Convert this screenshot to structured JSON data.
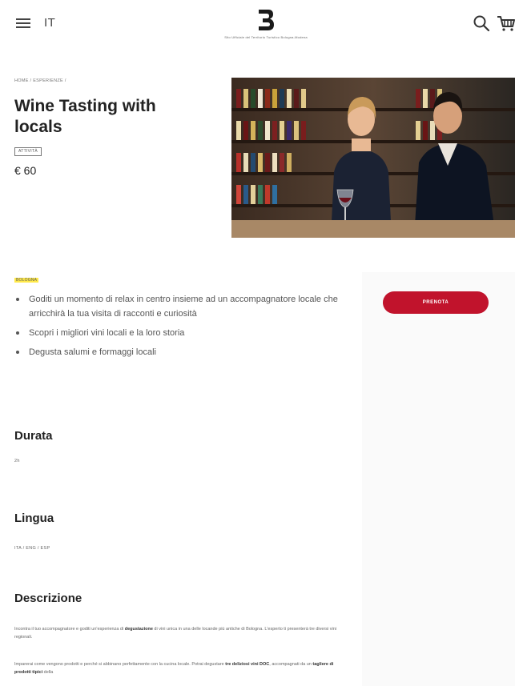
{
  "header": {
    "language": "IT",
    "logo_caption": "Sito Ufficiale del Territorio Turistico Bologna-Modena",
    "icons": [
      "menu-icon",
      "search-icon",
      "cart-icon"
    ]
  },
  "breadcrumb": {
    "home": "HOME",
    "separator": " / ",
    "section": "ESPERIENZE",
    "trailing": " /"
  },
  "product": {
    "title": "Wine Tasting with locals",
    "tag": "ATTIVITÀ",
    "price": "€ 60"
  },
  "details": {
    "city": "BOLOGNA",
    "highlights": [
      "Goditi un momento di relax in centro insieme ad un accompagnatore locale che arricchirà la tua visita di racconti e curiosità",
      "Scopri i migliori vini locali e la loro storia",
      "Degusta salumi e formaggi locali"
    ],
    "duration_title": "Durata",
    "duration_value": "2h",
    "language_title": "Lingua",
    "language_value": "ITA / ENG / ESP",
    "description_title": "Descrizione",
    "description_p1_a": "Incontra il tuo accompagnatore e goditi un'esperienza di ",
    "description_p1_b": "degustazione",
    "description_p1_c": " di vini unica in una delle locande più antiche di Bologna. L'esperto ti presenterà tre diversi vini regionali.",
    "description_p2_a": "Imparerai come vengono prodotti e perché si abbinano perfettamente con la cucina locale. Potrai degustare ",
    "description_p2_b": "tre deliziosi vini DOC",
    "description_p2_c": ", accompagnati da un ",
    "description_p2_d": "tagliere di prodotti tipici",
    "description_p2_e": " della"
  },
  "booking": {
    "button_label": "PRENOTA"
  },
  "colors": {
    "accent": "#c1132c",
    "highlight": "#ffe94a"
  }
}
